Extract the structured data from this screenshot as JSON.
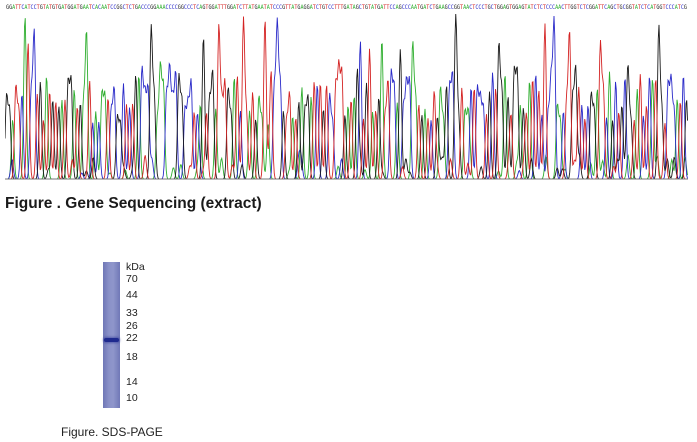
{
  "sequencing": {
    "read": "GGATTCATCCTGTATGTGATGGATGAATCACAATCCGGCTCTGACCCGGAAACCCCGGCCCTCAGTGGATTTGGATCTTATGAATATCCCGTTATGAGGATCTGTCCTTTGATAGCTGTATGATTCCAGCCCAATGATCTGAAGCCGGTAACTCCCTGCTGGAGTGGAGTATCTCTCCCAACTTGGTCTCGGATTCAGCTGCGGTATCTCATGGTCCCATCG",
    "colors": {
      "A": "#2fae2f",
      "C": "#2b2bc9",
      "G": "#1a1a1a",
      "T": "#d42424"
    },
    "caption": "Figure . Gene Sequencing (extract)"
  },
  "gel": {
    "unit_label": "kDa",
    "markers": [
      "70",
      "44",
      "33",
      "26",
      "22",
      "18",
      "14",
      "10"
    ],
    "band_marker": "22",
    "caption": "Figure. SDS-PAGE"
  }
}
